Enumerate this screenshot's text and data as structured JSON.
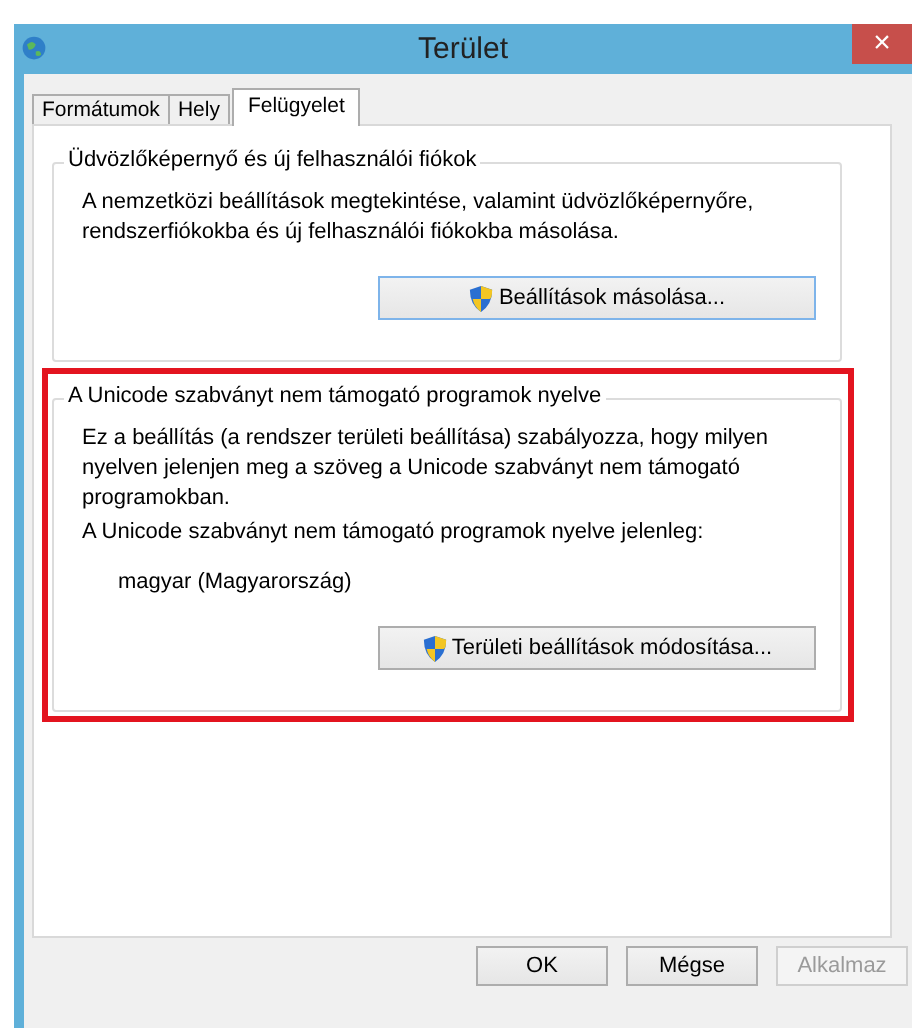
{
  "window": {
    "title": "Terület",
    "close": "×"
  },
  "tabs": [
    {
      "label": "Formátumok",
      "selected": false
    },
    {
      "label": "Hely",
      "selected": false
    },
    {
      "label": "Felügyelet",
      "selected": true
    }
  ],
  "groups": [
    {
      "title": "Üdvözlőképernyő és új felhasználói fiókok",
      "highlighted": false,
      "texts": [
        {
          "kind": "text",
          "text": "A nemzetközi beállítások megtekintése, valamint üdvözlőképernyőre, rendszerfiókokba és új felhasználói fiókokba másolása."
        }
      ],
      "button": {
        "label": "Beállítások másolása...",
        "shield": true,
        "focused": true
      }
    },
    {
      "title": "A Unicode szabványt nem támogató programok nyelve",
      "highlighted": true,
      "texts": [
        {
          "kind": "text",
          "text": "Ez a beállítás (a rendszer területi beállítása) szabályozza, hogy milyen nyelven jelenjen meg a szöveg a Unicode szabványt nem támogató programokban."
        },
        {
          "kind": "text",
          "text": "A Unicode szabványt nem támogató programok nyelve jelenleg:"
        },
        {
          "kind": "value",
          "text": "magyar (Magyarország)"
        }
      ],
      "button": {
        "label": "Területi beállítások módosítása...",
        "shield": true,
        "focused": false
      }
    }
  ],
  "buttons": [
    {
      "label": "OK",
      "disabled": false
    },
    {
      "label": "Mégse",
      "disabled": false
    },
    {
      "label": "Alkalmaz",
      "disabled": true
    }
  ]
}
